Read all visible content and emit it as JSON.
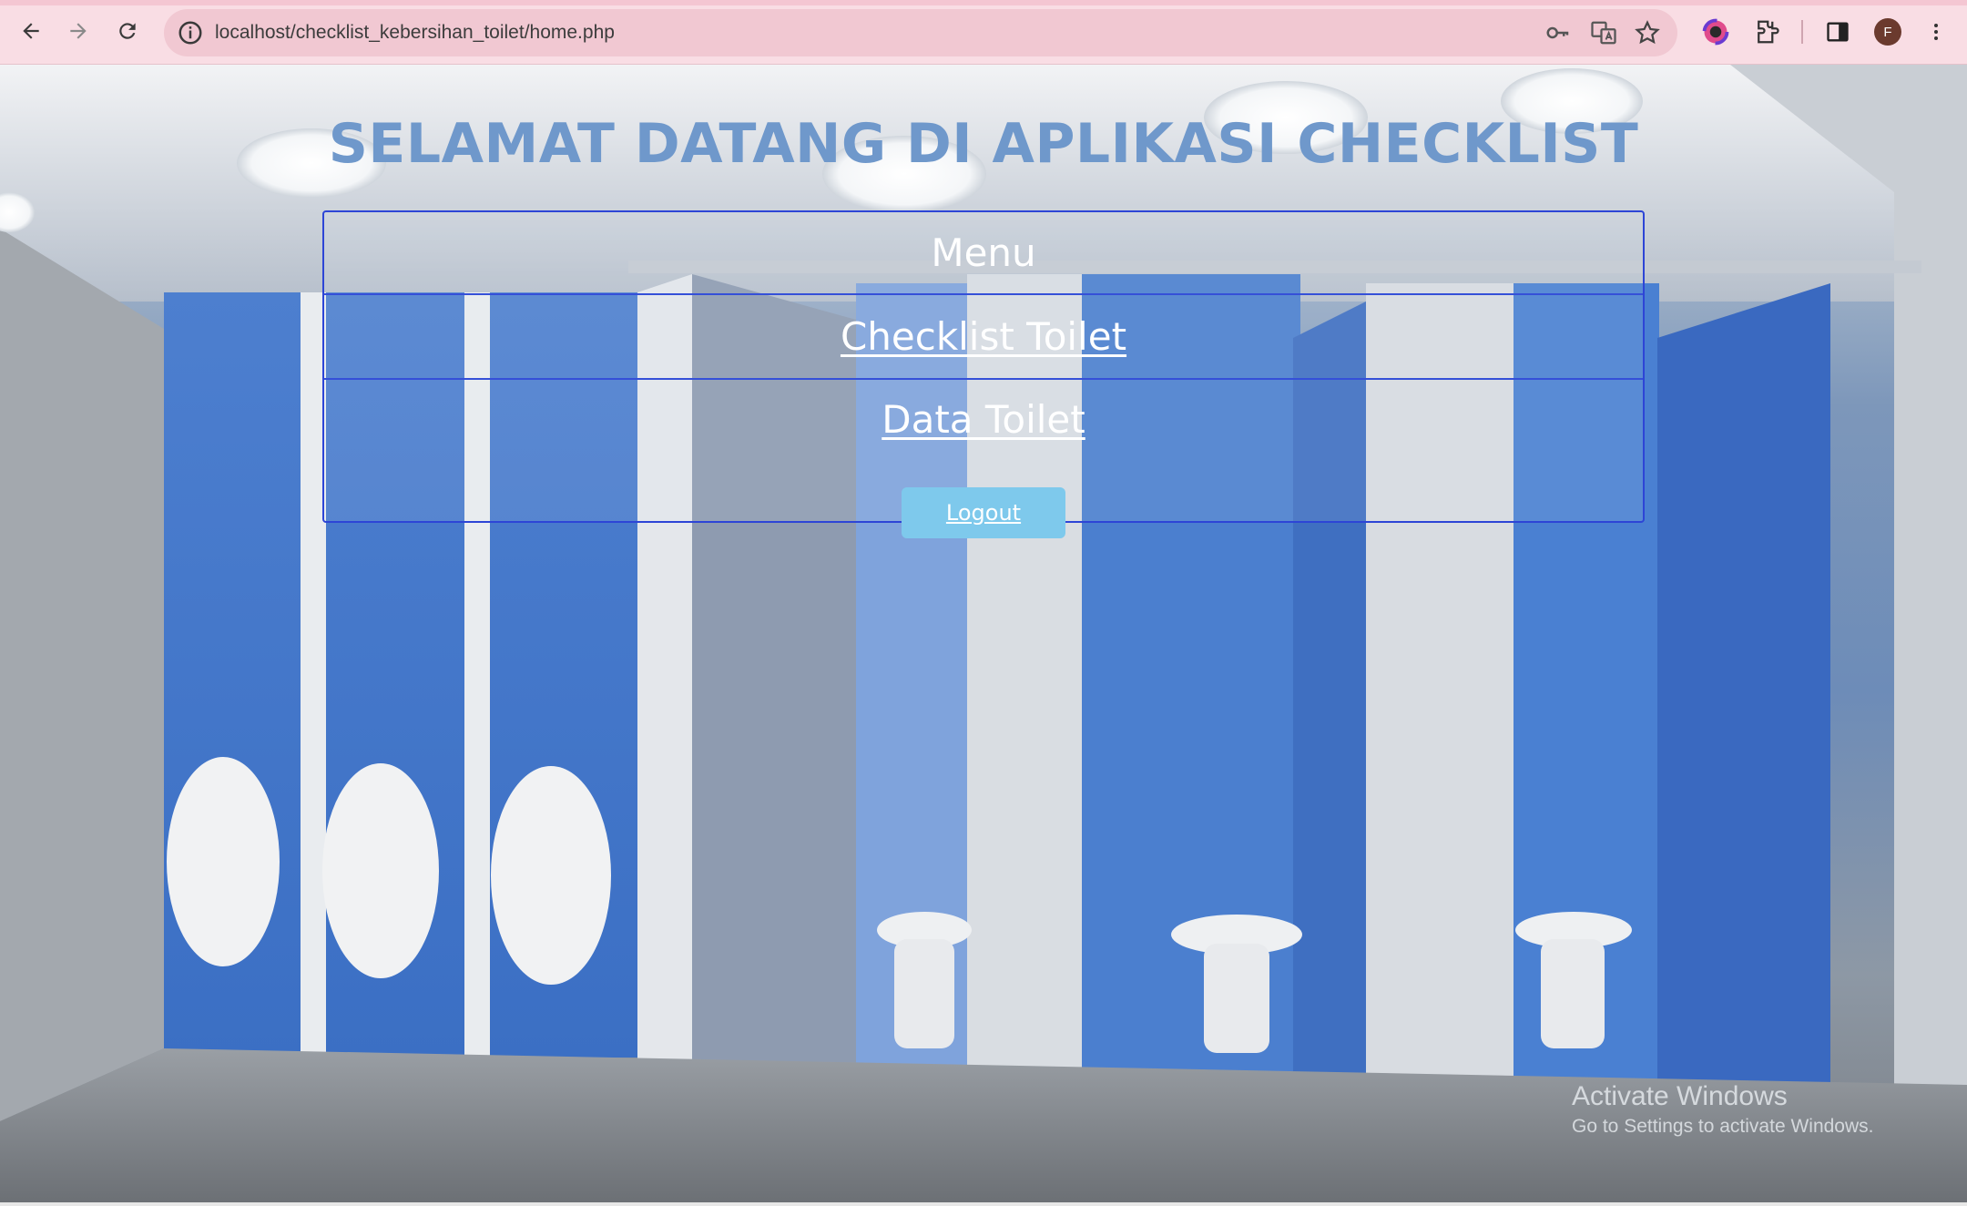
{
  "browser": {
    "url": "localhost/checklist_kebersihan_toilet/home.php",
    "profile_initial": "F",
    "icons": [
      "back-icon",
      "forward-icon",
      "reload-icon",
      "site-info-icon",
      "password-key-icon",
      "translate-icon",
      "bookmark-star-icon",
      "color-extension-icon",
      "extensions-puzzle-icon",
      "side-panel-icon",
      "more-menu-icon"
    ]
  },
  "page": {
    "title": "SELAMAT DATANG DI APLIKASI CHECKLIST",
    "menu": {
      "heading": "Menu",
      "items": [
        {
          "label": "Checklist Toilet"
        },
        {
          "label": "Data Toilet"
        }
      ]
    },
    "logout_label": "Logout"
  },
  "watermark": {
    "title": "Activate Windows",
    "subtitle": "Go to Settings to activate Windows."
  },
  "colors": {
    "title": "#6f98cb",
    "menu_border": "#2d45d6",
    "logout_button": "#7ec9ec",
    "toolbar": "#f9dde4"
  }
}
